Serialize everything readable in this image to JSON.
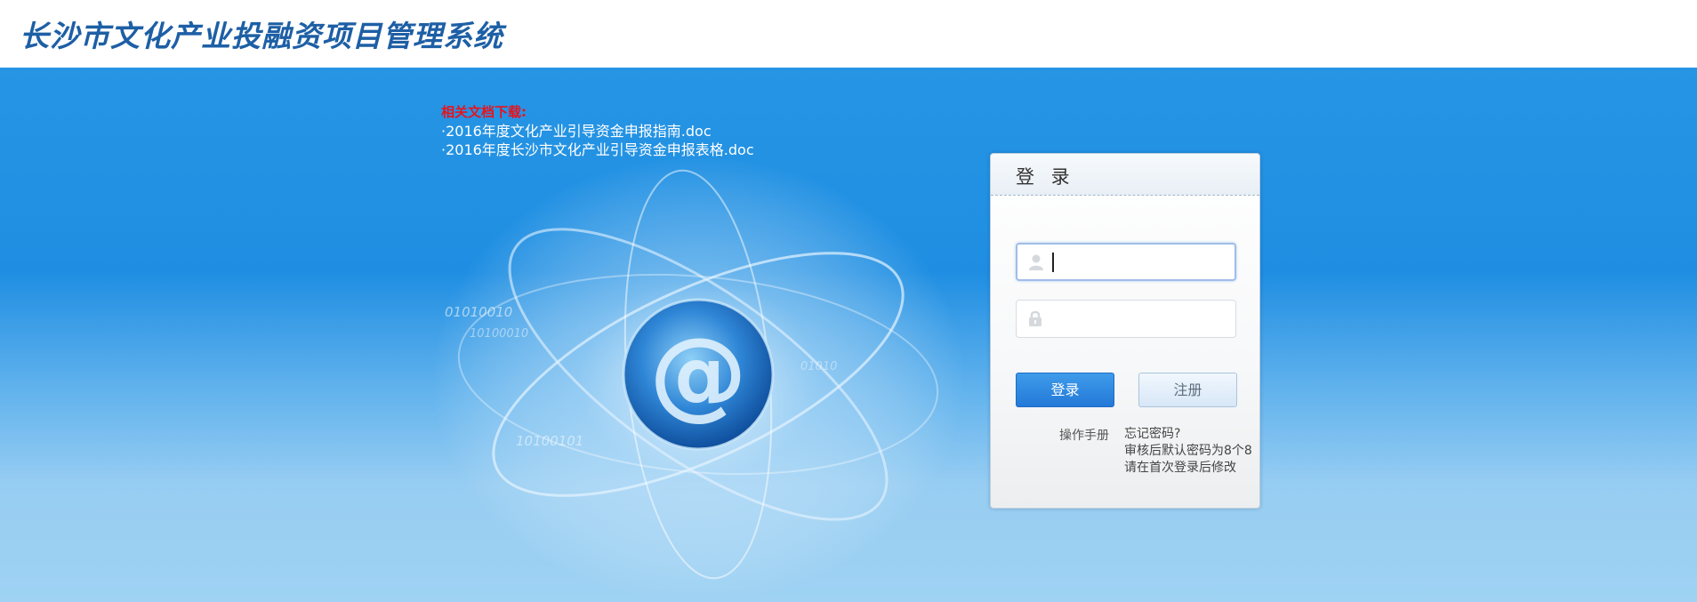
{
  "header": {
    "title": "长沙市文化产业投融资项目管理系统"
  },
  "downloads": {
    "title": "相关文档下载:",
    "items": [
      "·2016年度文化产业引导资金申报指南.doc",
      "·2016年度长沙市文化产业引导资金申报表格.doc"
    ]
  },
  "illustration": {
    "symbol": "@",
    "binary_texts": [
      "01010010",
      "10100010",
      "10100101",
      "01010"
    ]
  },
  "login": {
    "title": "登 录",
    "username_value": "",
    "password_value": "",
    "username_icon": "user-icon",
    "password_icon": "lock-icon",
    "login_button": "登录",
    "register_button": "注册",
    "manual_link": "操作手册",
    "forgot_label": "忘记密码?",
    "forgot_note_1": "审核后默认密码为8个8",
    "forgot_note_2": "请在首次登录后修改"
  },
  "colors": {
    "title_blue": "#1d5fa5",
    "background_blue": "#1f8ee2",
    "download_title_red": "#e8131d",
    "login_button_blue": "#2379d8"
  }
}
